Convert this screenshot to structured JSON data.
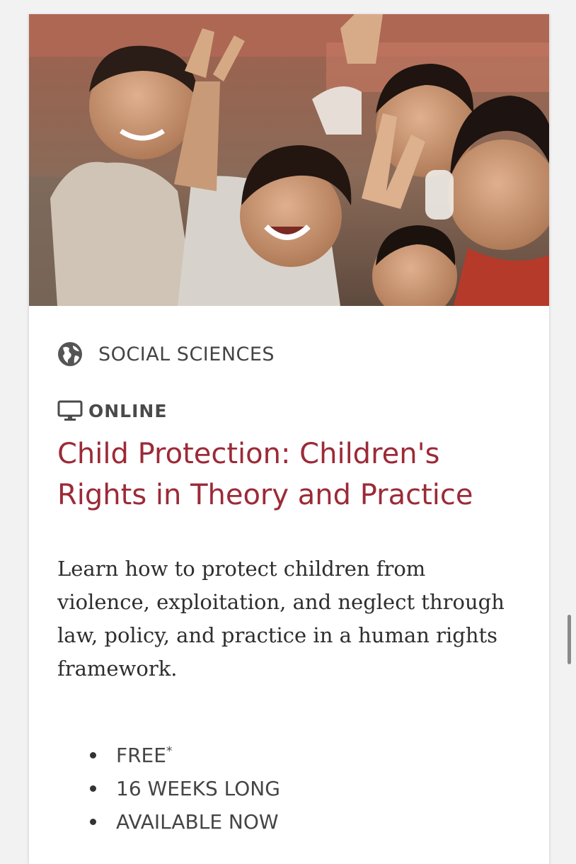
{
  "course": {
    "image_alt": "Smiling children making peace signs",
    "category": "SOCIAL SCIENCES",
    "category_icon": "globe-icon",
    "format": "ONLINE",
    "format_icon": "monitor-icon",
    "title": "Child Protection: Children's Rights in Theory and Practice",
    "description": "Learn how to protect children from violence, exploitation, and neglect through law, policy, and practice in a human rights framework.",
    "facts": [
      {
        "text": "FREE",
        "marker": "*"
      },
      {
        "text": "16 WEEKS LONG"
      },
      {
        "text": "AVAILABLE NOW"
      }
    ]
  },
  "colors": {
    "title": "#9c2a37",
    "text": "#2e2e2e",
    "muted": "#444444",
    "page_bg": "#f2f2f2"
  }
}
